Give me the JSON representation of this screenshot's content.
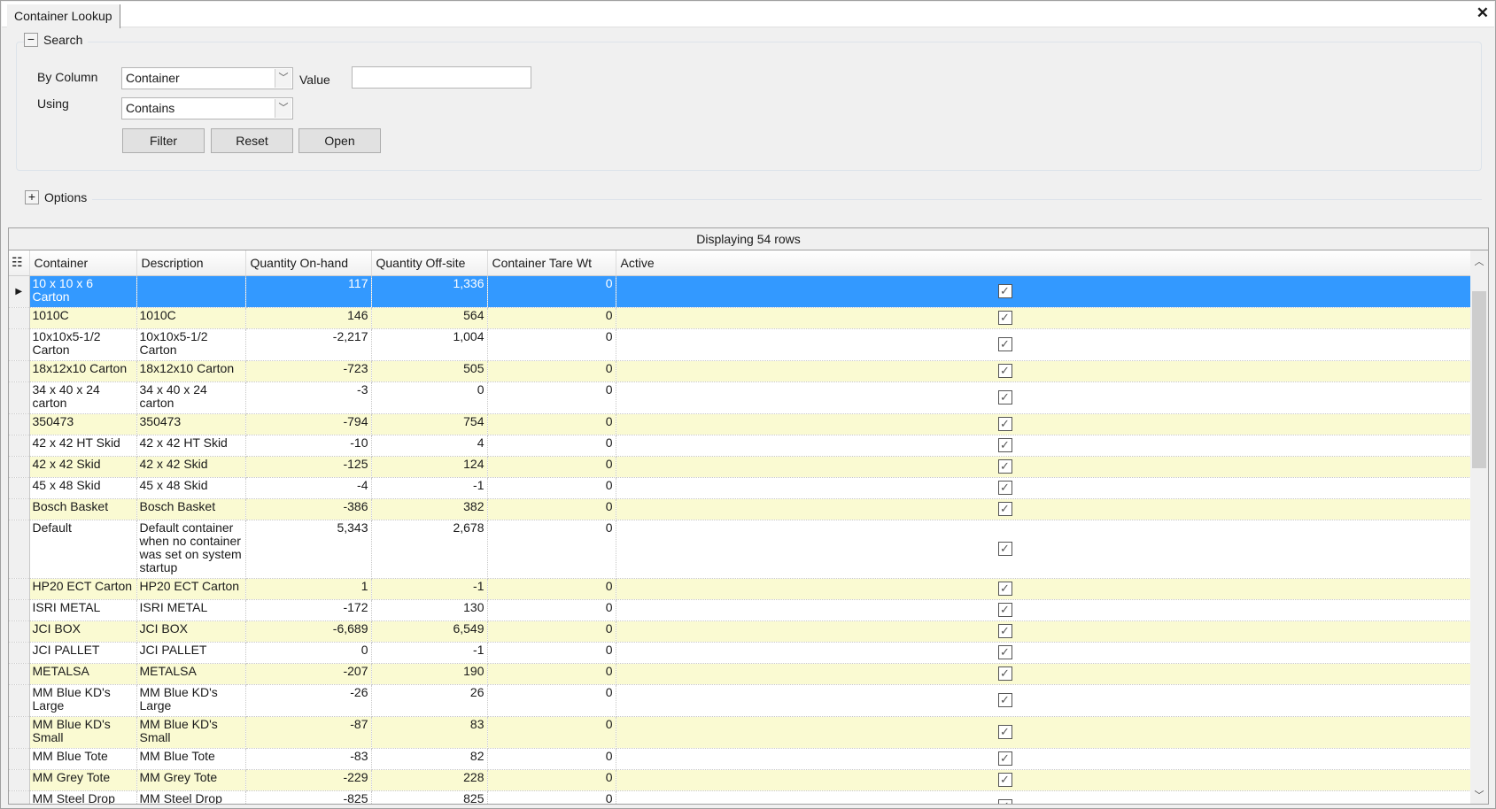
{
  "window": {
    "tab": "Container Lookup",
    "close_icon": "close-icon"
  },
  "search": {
    "title": "Search",
    "toggle": "−",
    "by_column_label": "By Column",
    "by_column_value": "Container",
    "value_label": "Value",
    "value": "",
    "using_label": "Using",
    "using_value": "Contains",
    "filter": "Filter",
    "reset": "Reset",
    "open": "Open"
  },
  "options": {
    "title": "Options",
    "toggle": "+"
  },
  "grid": {
    "caption": "Displaying 54 rows",
    "columns": [
      "Container",
      "Description",
      "Quantity On-hand",
      "Quantity Off-site",
      "Container Tare Wt",
      "Active"
    ],
    "selected_row": 0,
    "colors": {
      "selected": "#3399ff",
      "alternate": "#fafad2"
    },
    "rows": [
      [
        "10 x 10 x 6 Carton",
        "",
        "117",
        "1,336",
        "0",
        true
      ],
      [
        "1010C",
        "1010C",
        "146",
        "564",
        "0",
        true
      ],
      [
        "10x10x5-1/2 Carton",
        "10x10x5-1/2 Carton",
        "-2,217",
        "1,004",
        "0",
        true
      ],
      [
        "18x12x10 Carton",
        "18x12x10 Carton",
        "-723",
        "505",
        "0",
        true
      ],
      [
        "34 x 40 x 24 carton",
        "34 x 40 x 24 carton",
        "-3",
        "0",
        "0",
        true
      ],
      [
        "350473",
        "350473",
        "-794",
        "754",
        "0",
        true
      ],
      [
        "42 x 42 HT Skid",
        "42 x 42 HT Skid",
        "-10",
        "4",
        "0",
        true
      ],
      [
        "42 x 42 Skid",
        "42 x 42 Skid",
        "-125",
        "124",
        "0",
        true
      ],
      [
        "45 x 48 Skid",
        "45 x 48 Skid",
        "-4",
        "-1",
        "0",
        true
      ],
      [
        "Bosch Basket",
        "Bosch Basket",
        "-386",
        "382",
        "0",
        true
      ],
      [
        "Default",
        "Default container when no container was set on system startup",
        "5,343",
        "2,678",
        "0",
        true
      ],
      [
        "HP20 ECT Carton",
        "HP20 ECT Carton",
        "1",
        "-1",
        "0",
        true
      ],
      [
        "ISRI METAL",
        "ISRI METAL",
        "-172",
        "130",
        "0",
        true
      ],
      [
        "JCI BOX",
        "JCI BOX",
        "-6,689",
        "6,549",
        "0",
        true
      ],
      [
        "JCI PALLET",
        "JCI PALLET",
        "0",
        "-1",
        "0",
        true
      ],
      [
        "METALSA",
        "METALSA",
        "-207",
        "190",
        "0",
        true
      ],
      [
        "MM Blue KD's Large",
        "MM Blue KD's Large",
        "-26",
        "26",
        "0",
        true
      ],
      [
        "MM Blue KD's Small",
        "MM Blue KD's Small",
        "-87",
        "83",
        "0",
        true
      ],
      [
        "MM Blue Tote",
        "MM Blue Tote",
        "-83",
        "82",
        "0",
        true
      ],
      [
        "MM Grey Tote",
        "MM Grey Tote",
        "-229",
        "228",
        "0",
        true
      ],
      [
        "MM Steel Drop Tub",
        "MM Steel Drop Tub",
        "-825",
        "825",
        "0",
        true
      ]
    ]
  }
}
